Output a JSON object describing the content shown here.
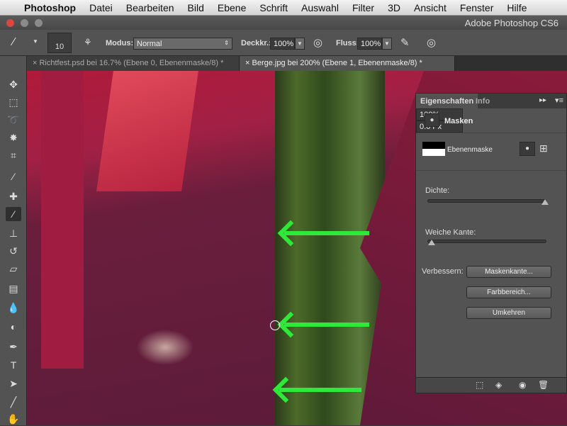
{
  "menubar": {
    "apple": "",
    "items": [
      "Photoshop",
      "Datei",
      "Bearbeiten",
      "Bild",
      "Ebene",
      "Schrift",
      "Auswahl",
      "Filter",
      "3D",
      "Ansicht",
      "Fenster",
      "Hilfe"
    ]
  },
  "window": {
    "title": "Adobe Photoshop CS6"
  },
  "options": {
    "brush_size": "10",
    "modus_label": "Modus:",
    "modus_value": "Normal",
    "deckkr_label": "Deckkr.:",
    "deckkr_value": "100%",
    "fluss_label": "Fluss:",
    "fluss_value": "100%"
  },
  "tabs": [
    {
      "label": "Richtfest.psd bei 16.7% (Ebene 0, Ebenenmaske/8) *",
      "active": false
    },
    {
      "label": "Berge.jpg bei 200% (Ebene 1, Ebenenmaske/8) *",
      "active": true
    }
  ],
  "panel": {
    "tabs": [
      "Eigenschaften",
      "Info"
    ],
    "section": "Masken",
    "mask_name": "Ebenenmaske",
    "dichte_label": "Dichte:",
    "dichte_value": "100%",
    "dichte_fraction": 1.0,
    "weiche_label": "Weiche Kante:",
    "weiche_value": "0.6 Px",
    "weiche_fraction": 0.0,
    "verbessern_label": "Verbessern:",
    "buttons": [
      "Maskenkante...",
      "Farbbereich...",
      "Umkehren"
    ]
  },
  "colors": {
    "arrow": "#2ee83a",
    "accent_bg": "#535353"
  }
}
